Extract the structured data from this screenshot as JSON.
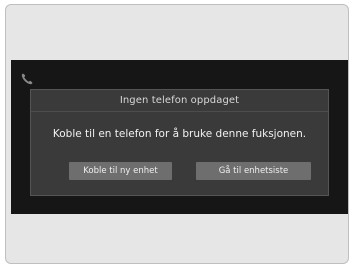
{
  "icons": {
    "phone": "phone-icon"
  },
  "dialog": {
    "title": "Ingen telefon oppdaget",
    "message": "Koble til en telefon for å bruke denne fuksjonen.",
    "buttons": {
      "connect_label": "Koble til ny enhet",
      "device_list_label": "Gå til enhetsiste"
    }
  },
  "colors": {
    "screen_background": "#161616",
    "dialog_background": "#3a3a3a",
    "button_background": "#6e6e6e",
    "outer_background": "#e6e6e6"
  }
}
